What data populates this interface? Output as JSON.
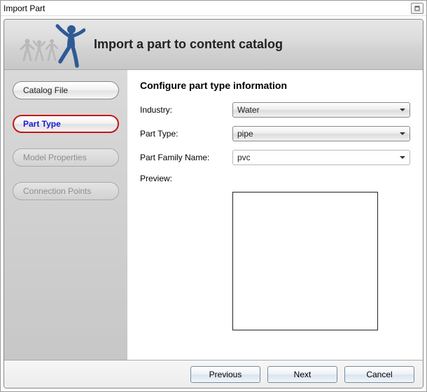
{
  "window": {
    "title": "Import Part"
  },
  "header": {
    "title": "Import a part to content catalog"
  },
  "nav": {
    "items": [
      {
        "label": "Catalog File",
        "state": "completed"
      },
      {
        "label": "Part Type",
        "state": "active"
      },
      {
        "label": "Model Properties",
        "state": "disabled"
      },
      {
        "label": "Connection Points",
        "state": "disabled"
      }
    ]
  },
  "main": {
    "section_title": "Configure part type information",
    "rows": {
      "industry": {
        "label": "Industry:",
        "value": "Water"
      },
      "part_type": {
        "label": "Part Type:",
        "value": "pipe"
      },
      "family": {
        "label": "Part Family Name:",
        "value": "pvc"
      },
      "preview": {
        "label": "Preview:"
      }
    }
  },
  "footer": {
    "previous": "Previous",
    "next": "Next",
    "cancel": "Cancel"
  }
}
